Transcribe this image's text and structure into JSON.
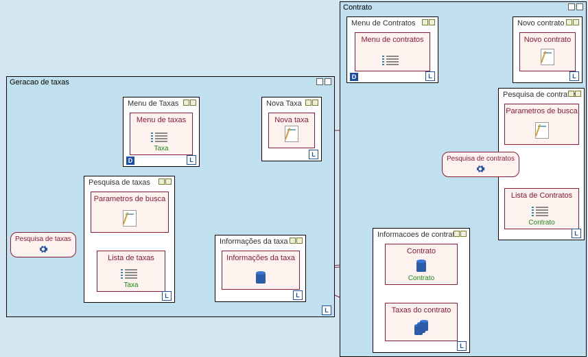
{
  "regions": {
    "taxas": {
      "title": "Geracao de taxas"
    },
    "contrato": {
      "title": "Contrato"
    }
  },
  "nodes": {
    "menuTaxas": {
      "title": "Menu de Taxas",
      "inner": "Menu de taxas",
      "footer": "Taxa"
    },
    "novaTaxa": {
      "title": "Nova Taxa",
      "inner": "Nova taxa"
    },
    "pesqTaxas": {
      "title": "Pesquisa de taxas",
      "p1": "Parametros de busca",
      "p2": "Lista de taxas",
      "footer": "Taxa"
    },
    "infoTaxa": {
      "title": "Informações da taxa",
      "inner": "Informações da taxa"
    },
    "menuContr": {
      "title": "Menu de Contratos",
      "inner": "Menu de contratos"
    },
    "novoContr": {
      "title": "Novo contrato",
      "inner": "Novo contrato"
    },
    "pesqContr": {
      "title": "Pesquisa de contratos",
      "p1": "Parametros de busca",
      "p2": "Lista de Contratos",
      "footer": "Contrato"
    },
    "infoContr": {
      "title": "Informacoes de contrato",
      "p1": "Contrato",
      "footer": "Contrato",
      "p2": "Taxas do contrato"
    }
  },
  "actions": {
    "pesqTaxas": "Pesquisa de taxas",
    "pesqContr": "Pesquisa de contratos"
  }
}
